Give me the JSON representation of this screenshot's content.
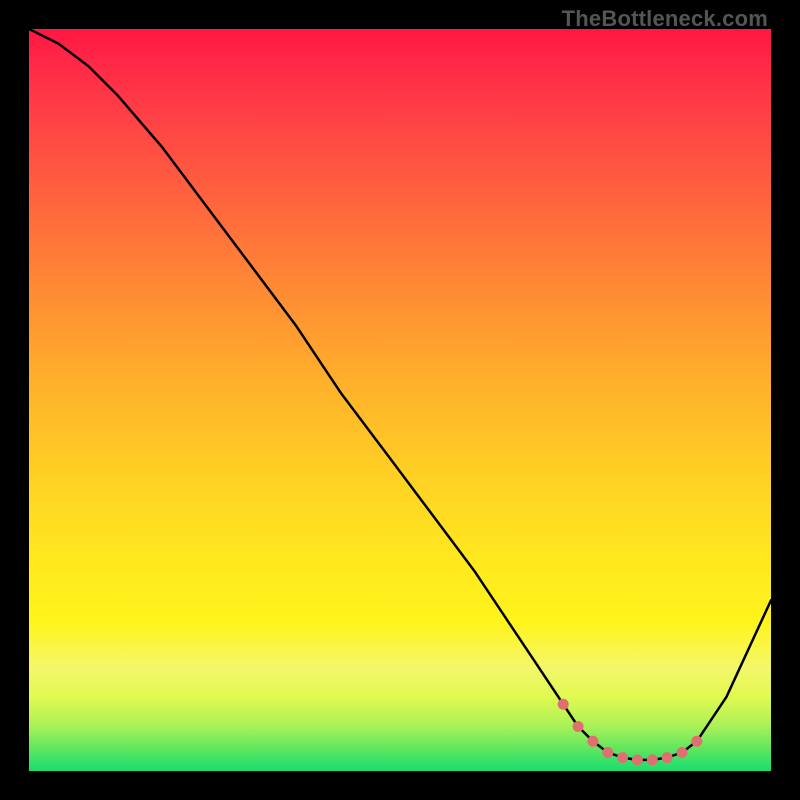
{
  "watermark": "TheBottleneck.com",
  "colors": {
    "frame": "#000000",
    "curve": "#000000",
    "dot_fill": "#e07070",
    "dot_stroke": "#b85252",
    "gradient_top": "#ff1744",
    "gradient_mid": "#ffe91e",
    "gradient_bottom": "#1ddd6f"
  },
  "chart_data": {
    "type": "line",
    "title": "",
    "xlabel": "",
    "ylabel": "",
    "xlim": [
      0,
      100
    ],
    "ylim": [
      0,
      100
    ],
    "x": [
      0,
      4,
      8,
      12,
      18,
      24,
      30,
      36,
      42,
      48,
      54,
      60,
      64,
      68,
      72,
      74,
      76,
      78,
      80,
      82,
      84,
      86,
      88,
      90,
      94,
      100
    ],
    "y": [
      100,
      98,
      95,
      91,
      84,
      76,
      68,
      60,
      51,
      43,
      35,
      27,
      21,
      15,
      9,
      6,
      4,
      2.5,
      1.8,
      1.5,
      1.5,
      1.8,
      2.5,
      4,
      10,
      23
    ],
    "dot_x": [
      72,
      74,
      76,
      78,
      80,
      82,
      84,
      86,
      88,
      90
    ],
    "dot_y": [
      9,
      6,
      4,
      2.5,
      1.8,
      1.5,
      1.5,
      1.8,
      2.5,
      4
    ]
  }
}
